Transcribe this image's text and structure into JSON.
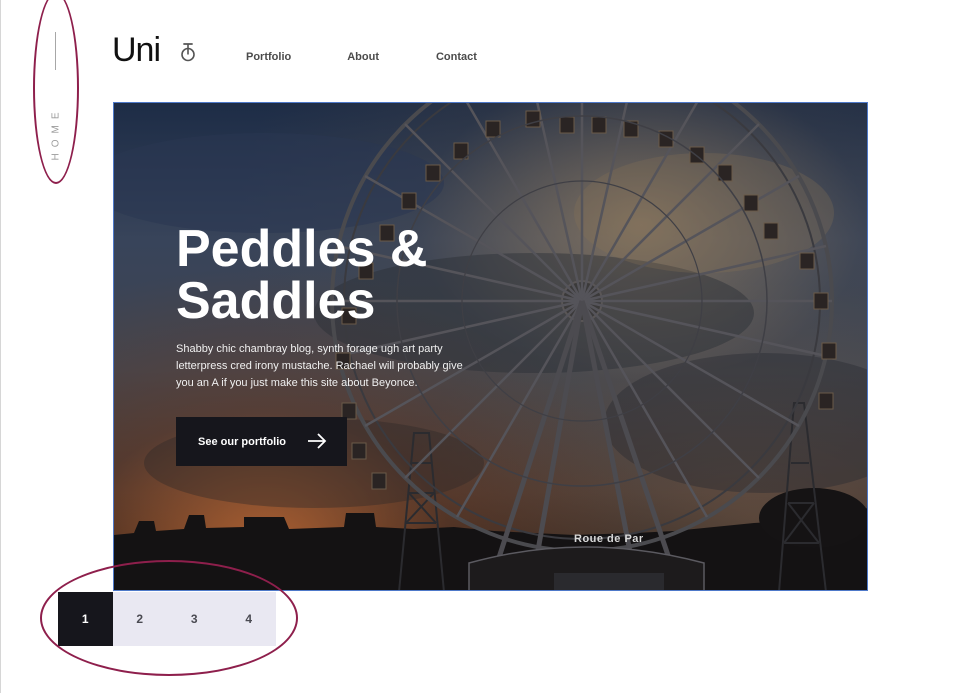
{
  "side": {
    "vertical_label": "HOME"
  },
  "header": {
    "logo": "Uni",
    "logo_icon": "unicycle-icon",
    "nav": [
      "Portfolio",
      "About",
      "Contact"
    ]
  },
  "hero": {
    "title_line1": "Peddles &",
    "title_line2": "Saddles",
    "text": "Shabby chic chambray blog, synth forage ugh art party letterpress cred irony mustache. Rachael will probably give you an A if you just make this site about Beyonce.",
    "cta_label": "See our portfolio",
    "cta_icon": "arrow-right-icon",
    "sign_text": "Roue de Par",
    "image_subject": "ferris-wheel"
  },
  "pagination": {
    "pages": [
      "1",
      "2",
      "3",
      "4"
    ],
    "active": "1"
  },
  "colors": {
    "dark": "#16161c",
    "pager_bg": "#e9e8f2",
    "annotation": "#8e1f4c",
    "hero_border": "#4e79c9"
  }
}
